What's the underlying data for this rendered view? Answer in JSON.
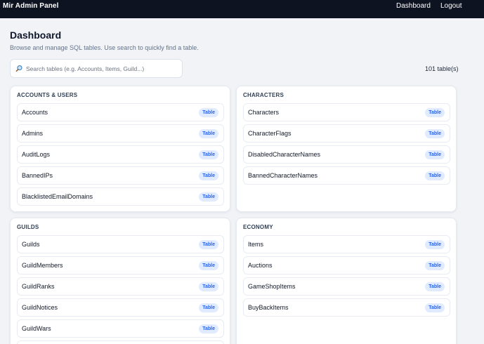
{
  "app": {
    "title": "Mir Admin Panel",
    "nav": {
      "dashboard": "Dashboard",
      "logout": "Logout"
    }
  },
  "header": {
    "title": "Dashboard",
    "subtitle": "Browse and manage SQL tables. Use search to quickly find a table."
  },
  "search": {
    "placeholder": "Search tables (e.g. Accounts, Items, Guild...)",
    "value": "",
    "icon": "search-icon"
  },
  "table_count": "101 table(s)",
  "colors": {
    "topbar": "#0d1321",
    "badge_bg": "#e0ebff",
    "badge_text": "#2563eb",
    "page_bg": "#f1f3f7"
  },
  "groups": [
    {
      "title": "ACCOUNTS & USERS",
      "items": [
        {
          "label": "Accounts",
          "badge": "Table"
        },
        {
          "label": "Admins",
          "badge": "Table"
        },
        {
          "label": "AuditLogs",
          "badge": "Table"
        },
        {
          "label": "BannedIPs",
          "badge": "Table"
        },
        {
          "label": "BlacklistedEmailDomains",
          "badge": "Table"
        }
      ]
    },
    {
      "title": "CHARACTERS",
      "items": [
        {
          "label": "Characters",
          "badge": "Table"
        },
        {
          "label": "CharacterFlags",
          "badge": "Table"
        },
        {
          "label": "DisabledCharacterNames",
          "badge": "Table"
        },
        {
          "label": "BannedCharacterNames",
          "badge": "Table"
        }
      ]
    },
    {
      "title": "GUILDS",
      "items": [
        {
          "label": "Guilds",
          "badge": "Table"
        },
        {
          "label": "GuildMembers",
          "badge": "Table"
        },
        {
          "label": "GuildRanks",
          "badge": "Table"
        },
        {
          "label": "GuildNotices",
          "badge": "Table"
        },
        {
          "label": "GuildWars",
          "badge": "Table"
        }
      ]
    },
    {
      "title": "ECONOMY",
      "items": [
        {
          "label": "Items",
          "badge": "Table"
        },
        {
          "label": "Auctions",
          "badge": "Table"
        },
        {
          "label": "GameShopItems",
          "badge": "Table"
        },
        {
          "label": "BuyBackItems",
          "badge": "Table"
        }
      ]
    }
  ]
}
